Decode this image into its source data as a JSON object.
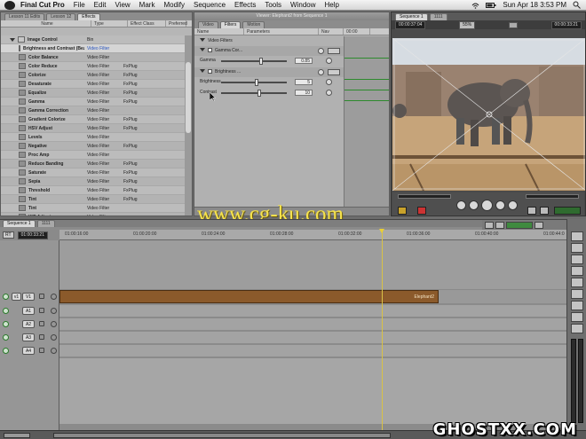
{
  "menubar": {
    "app_name": "Final Cut Pro",
    "items": [
      "File",
      "Edit",
      "View",
      "Mark",
      "Modify",
      "Sequence",
      "Effects",
      "Tools",
      "Window",
      "Help"
    ],
    "clock": "Sun Apr 18  3:53 PM"
  },
  "browser": {
    "tabs": [
      "Lesson 11 Edits",
      "Lesson 12",
      "Effects"
    ],
    "columns": [
      "Name",
      "Type",
      "Effect Class",
      "Preferred"
    ],
    "bin": {
      "name": "Image Control",
      "type": "Bin"
    },
    "rows": [
      {
        "name": "Brightness and Contrast (Bezier)",
        "type": "Video Filter",
        "class": ""
      },
      {
        "name": "Color Balance",
        "type": "Video Filter",
        "class": ""
      },
      {
        "name": "Color Reduce",
        "type": "Video Filter",
        "class": "FxPlug"
      },
      {
        "name": "Colorize",
        "type": "Video Filter",
        "class": "FxPlug"
      },
      {
        "name": "Desaturate",
        "type": "Video Filter",
        "class": "FxPlug"
      },
      {
        "name": "Equalize",
        "type": "Video Filter",
        "class": "FxPlug"
      },
      {
        "name": "Gamma",
        "type": "Video Filter",
        "class": "FxPlug"
      },
      {
        "name": "Gamma Correction",
        "type": "Video Filter",
        "class": ""
      },
      {
        "name": "Gradient Colorize",
        "type": "Video Filter",
        "class": "FxPlug"
      },
      {
        "name": "HSV Adjust",
        "type": "Video Filter",
        "class": "FxPlug"
      },
      {
        "name": "Levels",
        "type": "Video Filter",
        "class": ""
      },
      {
        "name": "Negative",
        "type": "Video Filter",
        "class": "FxPlug"
      },
      {
        "name": "Proc Amp",
        "type": "Video Filter",
        "class": ""
      },
      {
        "name": "Reduce Banding",
        "type": "Video Filter",
        "class": "FxPlug"
      },
      {
        "name": "Saturate",
        "type": "Video Filter",
        "class": "FxPlug"
      },
      {
        "name": "Sepia",
        "type": "Video Filter",
        "class": "FxPlug"
      },
      {
        "name": "Threshold",
        "type": "Video Filter",
        "class": "FxPlug"
      },
      {
        "name": "Tint",
        "type": "Video Filter",
        "class": "FxPlug"
      },
      {
        "name": "Tint",
        "type": "Video Filter",
        "class": ""
      },
      {
        "name": "YIQ Adjust",
        "type": "Video Filter",
        "class": ""
      }
    ]
  },
  "viewer": {
    "title": "Viewer: Elephant2 from Sequence 1",
    "tabs": [
      "Video",
      "Filters",
      "Motion"
    ],
    "columns": [
      "Name",
      "Parameters",
      "Nav",
      "00:00"
    ],
    "section": "Video Filters",
    "filter1": "Gamma Cor...",
    "gamma_label": "Gamma",
    "gamma_value": "0.85",
    "gamma_fraction": 0.58,
    "filter2": "Brightness ...",
    "brightness_label": "Brightness",
    "brightness_value": "5",
    "brightness_fraction": 0.52,
    "contrast_label": "Contrast",
    "contrast_value": "10",
    "contrast_fraction": 0.55
  },
  "canvas": {
    "tabs": [
      "Sequence 1",
      "1111"
    ],
    "tc_left": "00:00:37:04",
    "zoom": "55%",
    "tc_right": "00:00:33:21"
  },
  "watermark": "www.cg-ku.com",
  "timeline": {
    "tabs": [
      "Sequence 1",
      "1111"
    ],
    "rt": "RT",
    "timecode": "01:00:33:21",
    "ruler": [
      "01:00:16:00",
      "01:00:20:00",
      "01:00:24:00",
      "01:00:28:00",
      "01:00:32:00",
      "01:00:36:00",
      "01:00:40:00",
      "01:00:44:0"
    ],
    "tracks": {
      "v1_src": "v1",
      "v1": "V1",
      "a1": "A1",
      "a2": "A2",
      "a3": "A3",
      "a4": "A4"
    },
    "clip_name": "Elephant2"
  },
  "footer_brand": "GHOSTXX.COM"
}
